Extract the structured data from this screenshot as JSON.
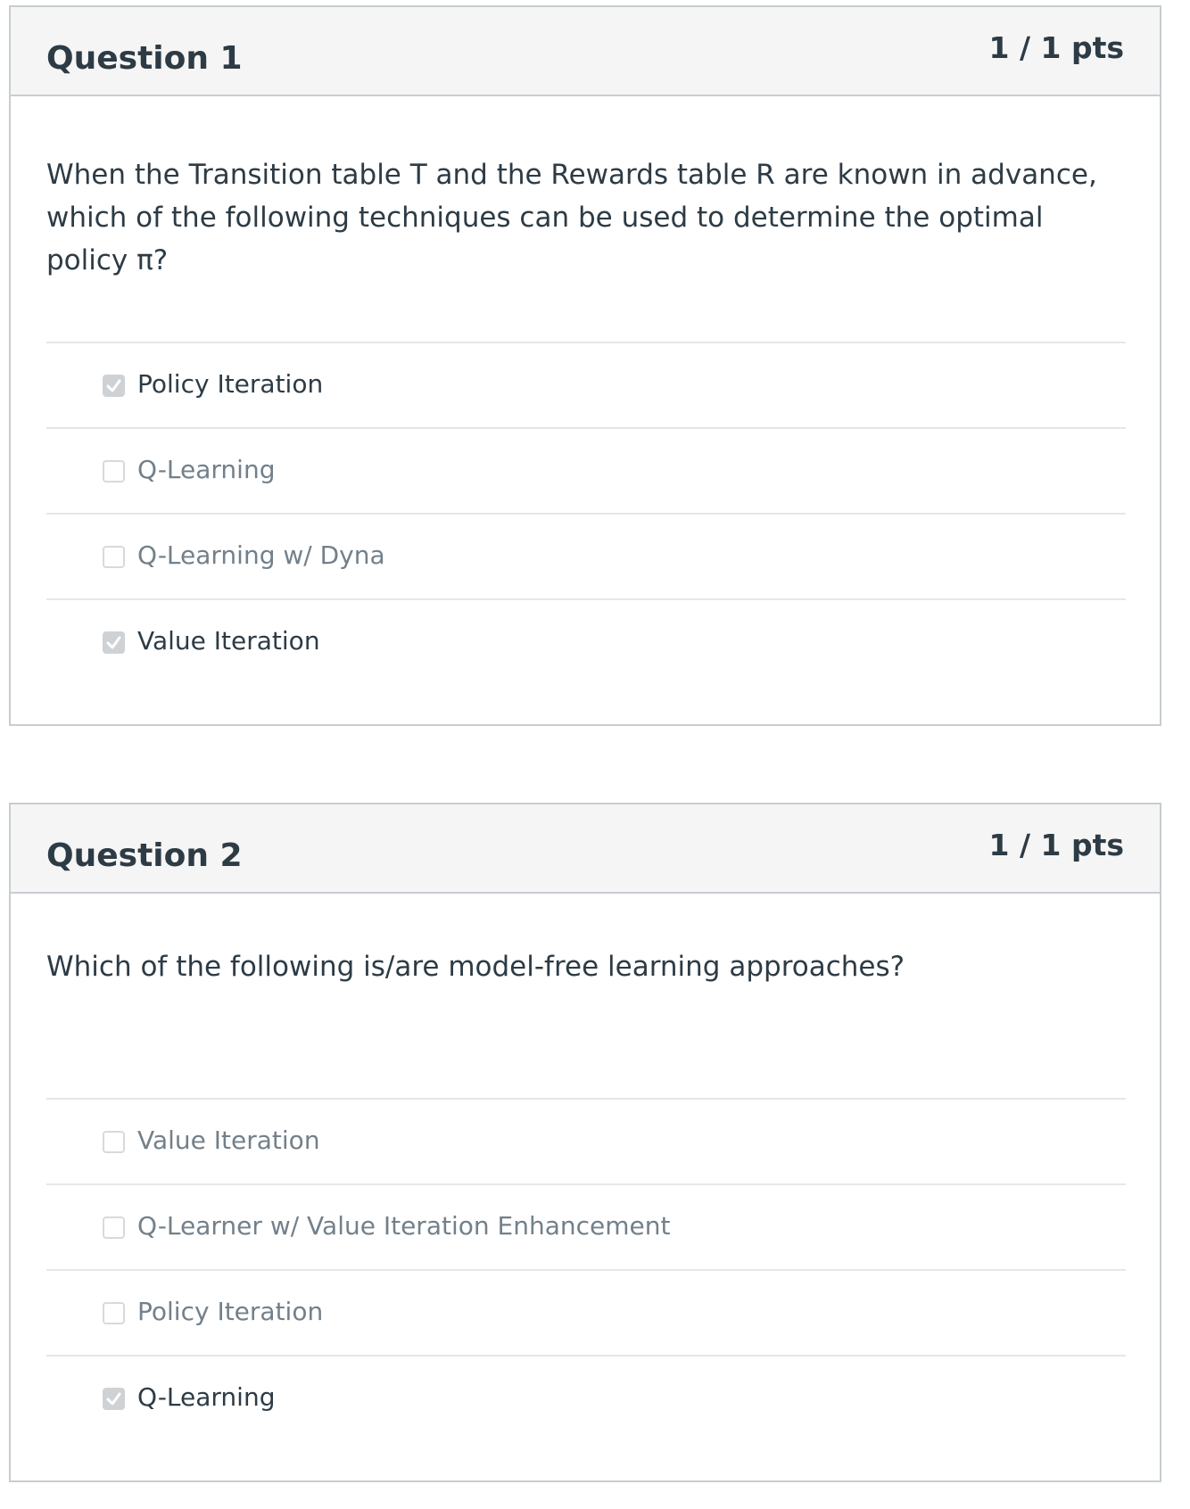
{
  "questions": [
    {
      "title": "Question 1",
      "points": "1 / 1 pts",
      "text": "When the Transition table T and the Rewards table R are known in advance, which of the following techniques can be used to determine the optimal policy π?",
      "answers": [
        {
          "label": "Policy Iteration",
          "checked": true
        },
        {
          "label": "Q-Learning",
          "checked": false
        },
        {
          "label": "Q-Learning w/ Dyna",
          "checked": false
        },
        {
          "label": "Value Iteration",
          "checked": true
        }
      ]
    },
    {
      "title": "Question 2",
      "points": "1 / 1 pts",
      "text": "Which of the following is/are model-free learning approaches?",
      "answers": [
        {
          "label": "Value Iteration",
          "checked": false
        },
        {
          "label": "Q-Learner w/ Value Iteration Enhancement",
          "checked": false
        },
        {
          "label": "Policy Iteration",
          "checked": false
        },
        {
          "label": "Q-Learning",
          "checked": true
        }
      ]
    }
  ],
  "colors": {
    "text": "#2d3b45",
    "muted_text": "#73808a",
    "header_bg": "#f5f5f5",
    "border": "#c7cdd1",
    "checked_box": "#cfd2d5"
  }
}
